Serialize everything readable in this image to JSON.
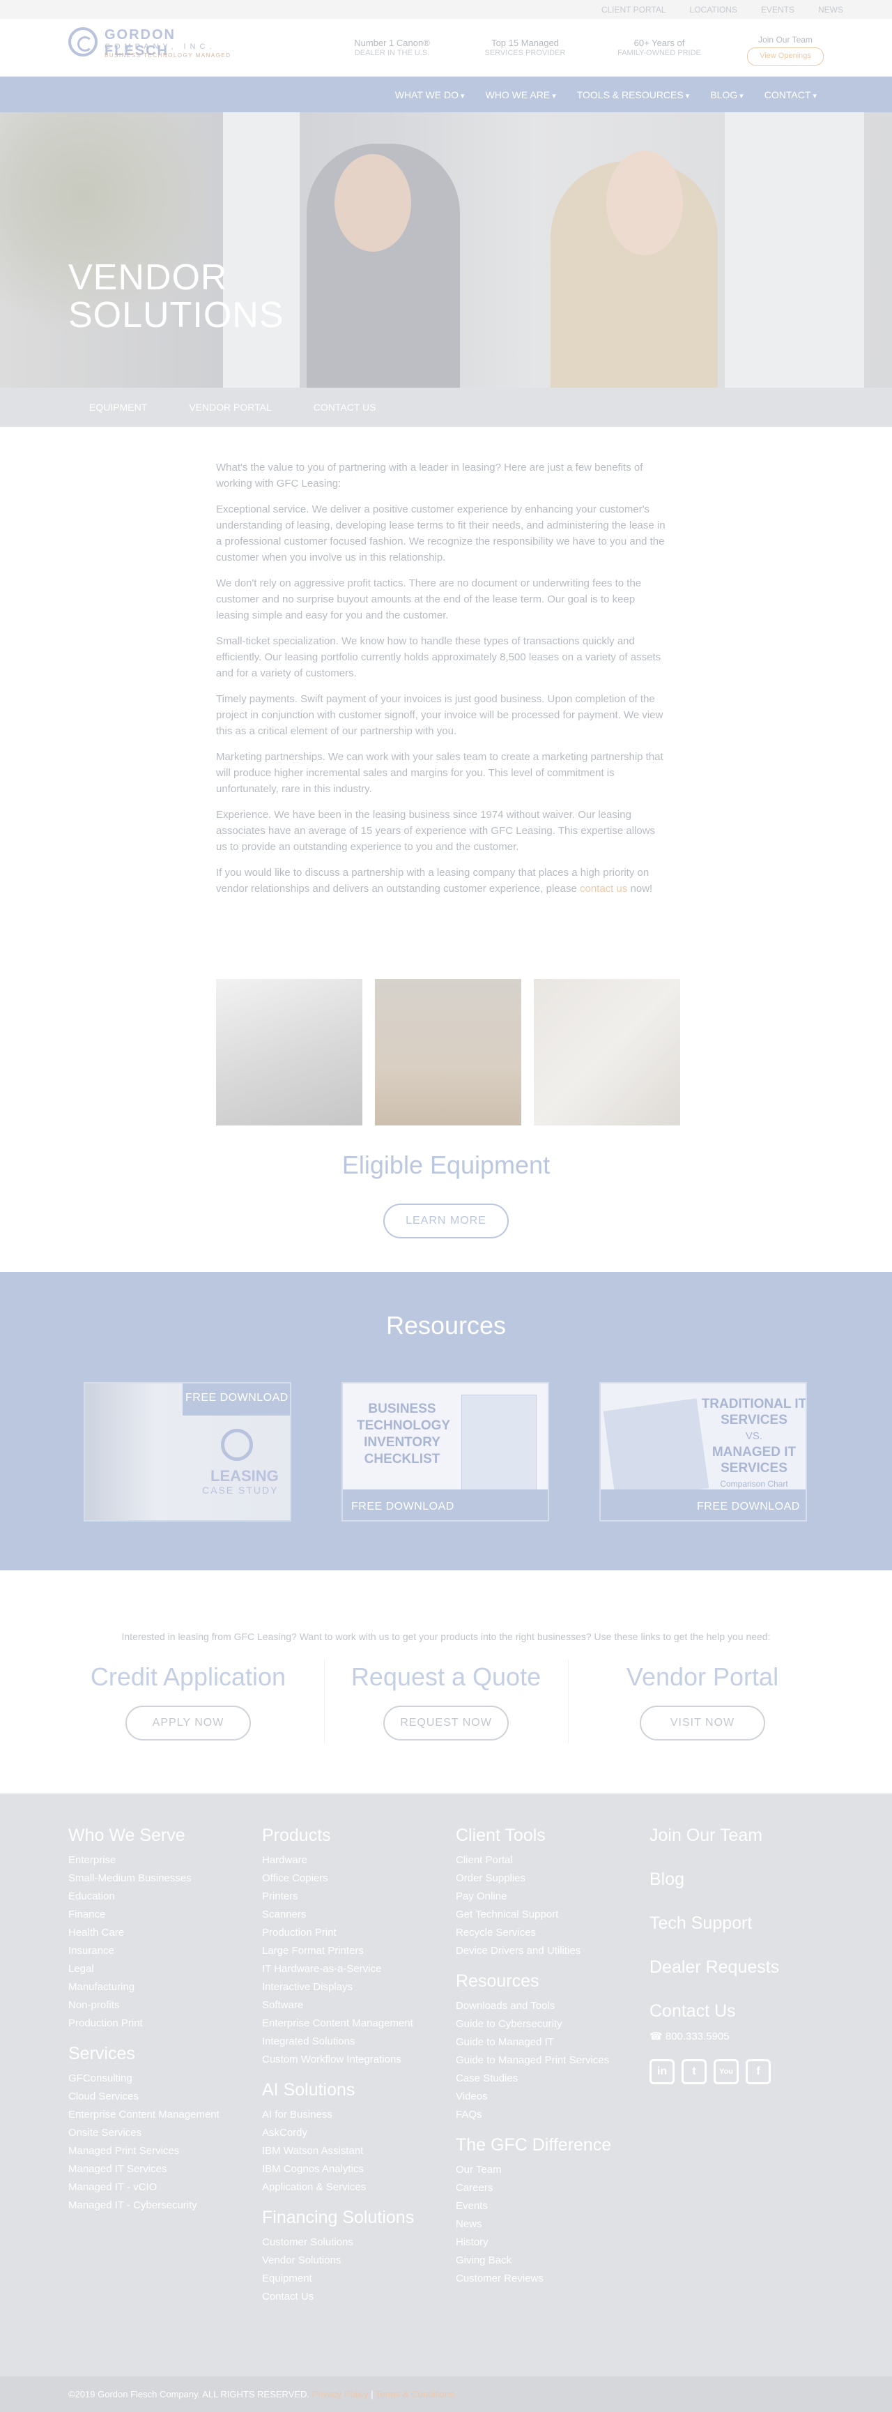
{
  "util_links": [
    "CLIENT PORTAL",
    "LOCATIONS",
    "EVENTS",
    "NEWS"
  ],
  "logo": {
    "name": "GORDON FLESCH",
    "company": "COMPANY, INC.",
    "tagline": "BUSINESS TECHNOLOGY MANAGED"
  },
  "stats": [
    {
      "line1": "Number 1 Canon®",
      "line2": "DEALER IN THE U.S."
    },
    {
      "line1": "Top 15 Managed",
      "line2": "SERVICES PROVIDER"
    },
    {
      "line1": "60+ Years of",
      "line2": "FAMILY-OWNED PRIDE"
    }
  ],
  "join": {
    "label": "Join Our Team",
    "button": "View Openings"
  },
  "nav": [
    "WHAT WE DO",
    "WHO WE ARE",
    "TOOLS & RESOURCES",
    "BLOG",
    "CONTACT"
  ],
  "hero": {
    "title": "VENDOR SOLUTIONS"
  },
  "subnav": [
    "EQUIPMENT",
    "VENDOR PORTAL",
    "CONTACT US"
  ],
  "content": {
    "p1": "What's the value to you of partnering with a leader in leasing? Here are just a few benefits of working with GFC Leasing:",
    "p2": "Exceptional service. We deliver a positive customer experience by enhancing your customer's understanding of leasing, developing lease terms to fit their needs, and administering the lease in a professional customer focused fashion. We recognize the responsibility we have to you and the customer when you involve us in this relationship.",
    "p3": "We don't rely on aggressive profit tactics. There are no document or underwriting fees to the customer and no surprise buyout amounts at the end of the lease term. Our goal is to keep leasing simple and easy for you and the customer.",
    "p4": "Small-ticket specialization. We know how to handle these types of transactions quickly and efficiently. Our leasing portfolio currently holds approximately 8,500 leases on a variety of assets and for a variety of customers.",
    "p5": "Timely payments. Swift payment of your invoices is just good business. Upon completion of the project in conjunction with customer signoff, your invoice will be processed for payment. We view this as a critical element of our partnership with you.",
    "p6": "Marketing partnerships. We can work with your sales team to create a marketing partnership that will produce higher incremental sales and margins for you. This level of commitment is unfortunately, rare in this industry.",
    "p7": "Experience. We have been in the leasing business since 1974 without waiver. Our leasing associates have an average of 15 years of experience with GFC Leasing. This expertise allows us to provide an outstanding experience to you and the customer.",
    "p8a": "If you would like to discuss a partnership with a leasing company that places a high priority on vendor relationships and delivers an outstanding customer experience, please ",
    "p8link": "contact us",
    "p8b": " now!"
  },
  "eligible": {
    "title": "Eligible Equipment",
    "button": "LEARN MORE"
  },
  "resources": {
    "title": "Resources",
    "card1": {
      "download": "FREE DOWNLOAD",
      "title": "LEASING",
      "subtitle": "CASE STUDY"
    },
    "card2": {
      "title": "BUSINESS TECHNOLOGY INVENTORY CHECKLIST",
      "download": "FREE DOWNLOAD"
    },
    "card3": {
      "t1": "TRADITIONAL IT SERVICES",
      "vs": "VS.",
      "t2": "MANAGED IT SERVICES",
      "t3": "Comparison Chart",
      "download": "FREE DOWNLOAD"
    }
  },
  "cta": {
    "intro": "Interested in leasing from GFC Leasing? Want to work with us to get your products into the right businesses? Use these links to get the help you need:",
    "items": [
      {
        "title": "Credit Application",
        "button": "APPLY NOW"
      },
      {
        "title": "Request a Quote",
        "button": "REQUEST NOW"
      },
      {
        "title": "Vendor Portal",
        "button": "VISIT NOW"
      }
    ]
  },
  "footer": {
    "who": {
      "title": "Who We Serve",
      "items": [
        "Enterprise",
        "Small-Medium Businesses",
        "Education",
        "Finance",
        "Health Care",
        "Insurance",
        "Legal",
        "Manufacturing",
        "Non-profits",
        "Production Print"
      ]
    },
    "services": {
      "title": "Services",
      "items": [
        "GFConsulting",
        "Cloud Services",
        "Enterprise Content Management",
        "Onsite Services",
        "Managed Print Services",
        "Managed IT Services",
        "Managed IT - vCIO",
        "Managed IT - Cybersecurity"
      ]
    },
    "products": {
      "title": "Products",
      "items": [
        "Hardware",
        "Office Copiers",
        "Printers",
        "Scanners",
        "Production Print",
        "Large Format Printers",
        "IT Hardware-as-a-Service",
        "Interactive Displays",
        "Software",
        "Enterprise Content Management",
        "Integrated Solutions",
        "Custom Workflow Integrations"
      ]
    },
    "ai": {
      "title": "AI Solutions",
      "items": [
        "AI for Business",
        "AskCordy",
        "IBM Watson Assistant",
        "IBM Cognos Analytics",
        "Application & Services"
      ]
    },
    "financing": {
      "title": "Financing Solutions",
      "items": [
        "Customer Solutions",
        "Vendor Solutions",
        "Equipment",
        "Contact Us"
      ]
    },
    "client": {
      "title": "Client Tools",
      "items": [
        "Client Portal",
        "Order Supplies",
        "Pay Online",
        "Get Technical Support",
        "Recycle Services",
        "Device Drivers and Utilities"
      ]
    },
    "resources": {
      "title": "Resources",
      "items": [
        "Downloads and Tools",
        "Guide to Cybersecurity",
        "Guide to Managed IT",
        "Guide to Managed Print Services",
        "Case Studies",
        "Videos",
        "FAQs"
      ]
    },
    "difference": {
      "title": "The GFC Difference",
      "items": [
        "Our Team",
        "Careers",
        "Events",
        "News",
        "History",
        "Giving Back",
        "Customer Reviews"
      ]
    },
    "right": {
      "join": "Join Our Team",
      "blog": "Blog",
      "tech": "Tech Support",
      "dealer": "Dealer Requests",
      "contact": "Contact Us",
      "phone": "800.333.5905"
    },
    "socials": [
      "in",
      "t",
      "You",
      "f"
    ]
  },
  "copyright": {
    "text": "©2019 Gordon Flesch Company. ALL RIGHTS RESERVED.",
    "privacy": "Privacy Policy",
    "sep": "|",
    "terms": "Terms & Conditions"
  }
}
